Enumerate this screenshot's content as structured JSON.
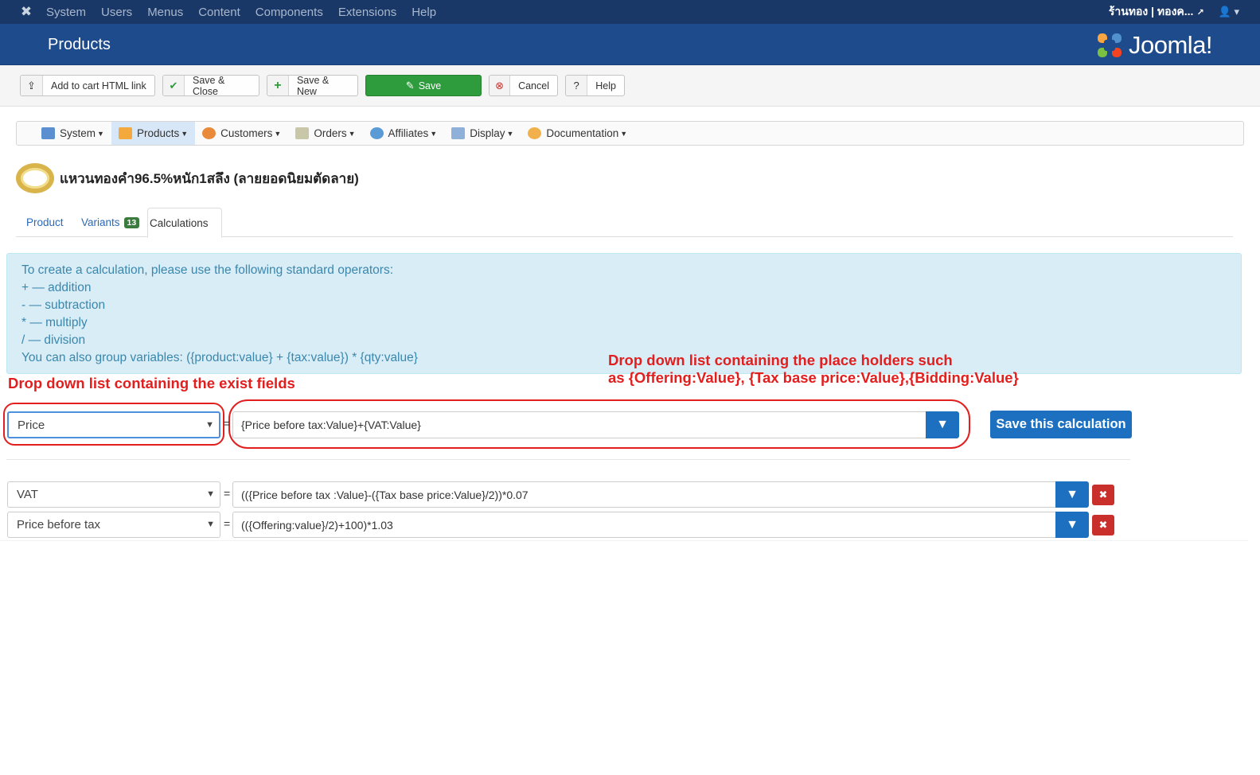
{
  "topnav": {
    "items": [
      "System",
      "Users",
      "Menus",
      "Content",
      "Components",
      "Extensions",
      "Help"
    ],
    "site_name": "ร้านทอง | ทองค...",
    "user_icon": "user-icon"
  },
  "header": {
    "title": "Products",
    "brand": "Joomla!",
    "bg_color": "#1d4b8b"
  },
  "toolbar": {
    "add_to_cart_label": "Add to cart HTML link",
    "save_close_label": "Save & Close",
    "save_new_label": "Save & New",
    "save_label": "Save",
    "cancel_label": "Cancel",
    "help_label": "Help"
  },
  "component_menu": {
    "items": [
      {
        "label": "System",
        "icon": "tools-icon"
      },
      {
        "label": "Products",
        "icon": "box-icon"
      },
      {
        "label": "Customers",
        "icon": "people-icon"
      },
      {
        "label": "Orders",
        "icon": "orders-icon"
      },
      {
        "label": "Affiliates",
        "icon": "affiliates-icon"
      },
      {
        "label": "Display",
        "icon": "display-icon"
      },
      {
        "label": "Documentation",
        "icon": "documentation-icon"
      }
    ],
    "active": "Products"
  },
  "product": {
    "title": "แหวนทองคำ96.5%หนัก1สลึง (ลายยอดนิยมตัดลาย)"
  },
  "tabs": {
    "product": "Product",
    "variants": "Variants",
    "variants_count": "13",
    "calculations": "Calculations"
  },
  "info": {
    "lines": [
      "To create a calculation, please use the following standard operators:",
      "+ — addition",
      "- — subtraction",
      "* — multiply",
      "/ — division",
      "You can also group variables: ({product:value} + {tax:value}) * {qty:value}"
    ]
  },
  "annotations": {
    "left": "Drop down list containing the exist fields",
    "right_line1": "Drop down list containing the place holders such",
    "right_line2": "as {Offering:Value}, {Tax base price:Value},{Bidding:Value}"
  },
  "new_calc": {
    "field": "Price",
    "equals": "=",
    "formula": "{Price before tax:Value}+{VAT:Value}",
    "save_label": "Save this calculation"
  },
  "calculations": [
    {
      "field": "VAT",
      "equals": "=",
      "formula": "(({Price before tax :Value}-({Tax base price:Value}/2))*0.07"
    },
    {
      "field": "Price before tax",
      "equals": "=",
      "formula": "(({Offering:value}/2)+100)*1.03"
    }
  ]
}
